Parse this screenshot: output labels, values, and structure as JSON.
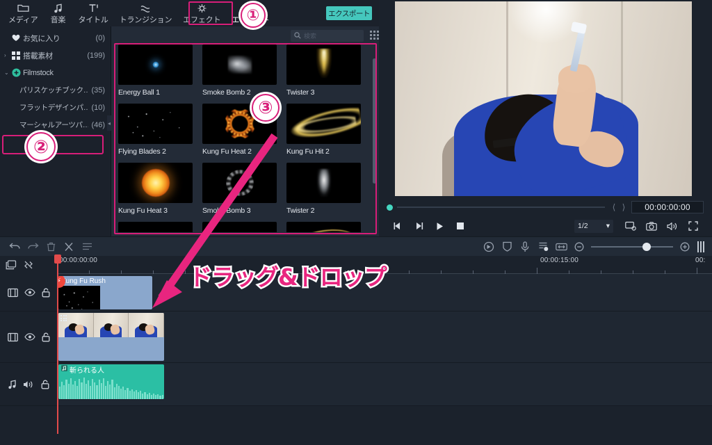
{
  "topbar": {
    "tabs": [
      {
        "label": "メディア",
        "icon": "folder-icon"
      },
      {
        "label": "音楽",
        "icon": "music-note-icon"
      },
      {
        "label": "タイトル",
        "icon": "title-text-icon"
      },
      {
        "label": "トランジション",
        "icon": "transition-icon"
      },
      {
        "label": "エフェクト",
        "icon": "effects-icon"
      },
      {
        "label": "エレメント",
        "icon": "elements-icon"
      }
    ],
    "active_tab": "エレメント",
    "export_label": "エクスポート"
  },
  "sidebar": {
    "items": [
      {
        "label": "お気に入り",
        "count": "(0)",
        "icon": "heart-icon",
        "indent": false,
        "caret": ""
      },
      {
        "label": "搭載素材",
        "count": "(199)",
        "icon": "grid-icon",
        "indent": false,
        "caret": "›"
      },
      {
        "label": "Filmstock",
        "count": "",
        "icon": "filmstock-icon",
        "indent": false,
        "caret": "⌄"
      },
      {
        "label": "パリスケッチブック…",
        "count": "(35)",
        "icon": "",
        "indent": true,
        "caret": ""
      },
      {
        "label": "フラットデザインパ…",
        "count": "(10)",
        "icon": "",
        "indent": true,
        "caret": ""
      },
      {
        "label": "マーシャルアーツパ…",
        "count": "(46)",
        "icon": "",
        "indent": true,
        "caret": ""
      }
    ],
    "selected_index": 5
  },
  "browser": {
    "search_placeholder": "検索",
    "search_value": "",
    "grid_view_icon": "grid-view-icon",
    "elements": [
      {
        "label": "Energy Ball 1",
        "art": "fx-energy"
      },
      {
        "label": "Smoke Bomb 2",
        "art": "fx-smoke"
      },
      {
        "label": "Twister 3",
        "art": "fx-twister3"
      },
      {
        "label": "Flying Blades 2",
        "art": "fx-sparks"
      },
      {
        "label": "Kung Fu Heat 2",
        "art": "fx-ring"
      },
      {
        "label": "Kung Fu Hit 2",
        "art": "fx-swoosh"
      },
      {
        "label": "Kung Fu Heat 3",
        "art": "fx-fireball"
      },
      {
        "label": "Smoke Bomb 3",
        "art": "fx-smokering"
      },
      {
        "label": "Twister 2",
        "art": "fx-twister2"
      },
      {
        "label": "",
        "art": "fx-goldsparks"
      },
      {
        "label": "",
        "art": ""
      },
      {
        "label": "",
        "art": "fx-arc"
      }
    ]
  },
  "preview": {
    "timecode": "00:00:00:00",
    "zoom_level": "1/2",
    "controls": [
      {
        "name": "prev-frame-button",
        "glyph": "◀"
      },
      {
        "name": "next-frame-button",
        "glyph": "▶"
      },
      {
        "name": "play-button",
        "glyph": "▶"
      },
      {
        "name": "stop-button",
        "glyph": "■"
      }
    ],
    "right_icons": [
      "screen-settings-icon",
      "snapshot-icon",
      "volume-icon",
      "fullscreen-icon"
    ]
  },
  "timeline": {
    "tools_left": [
      "undo-icon",
      "redo-icon",
      "delete-icon",
      "split-icon",
      "settings-icon"
    ],
    "tools_right": [
      "speed-icon",
      "mask-icon",
      "voiceover-icon",
      "auto-edit-icon",
      "fit-icon"
    ],
    "zoom_out_icon": "zoom-out-icon",
    "zoom_in_icon": "zoom-in-icon",
    "marker_icon": "marker-icon",
    "head_icons": [
      "add-track-icon",
      "unlink-icon"
    ],
    "ruler_start": "00:00:00:00",
    "ruler_marks": [
      "00:00:15:00",
      "00:"
    ],
    "tracks": [
      {
        "type": "video",
        "icons": [
          "film-icon",
          "eye-icon",
          "lock-icon"
        ]
      },
      {
        "type": "video",
        "icons": [
          "film-icon",
          "eye-icon",
          "lock-icon"
        ]
      },
      {
        "type": "audio",
        "icons": [
          "music-icon",
          "speaker-icon",
          "lock-icon"
        ]
      }
    ],
    "clips": [
      {
        "name": "Kung Fu Rush",
        "track": 0
      },
      {
        "name": "",
        "track": 1
      },
      {
        "name": "斬られる人",
        "track": 2
      }
    ]
  },
  "annotations": {
    "markers": [
      "①",
      "②",
      "③"
    ],
    "drag_text": "ドラッグ&ドロップ",
    "accent": "#d81e79"
  }
}
